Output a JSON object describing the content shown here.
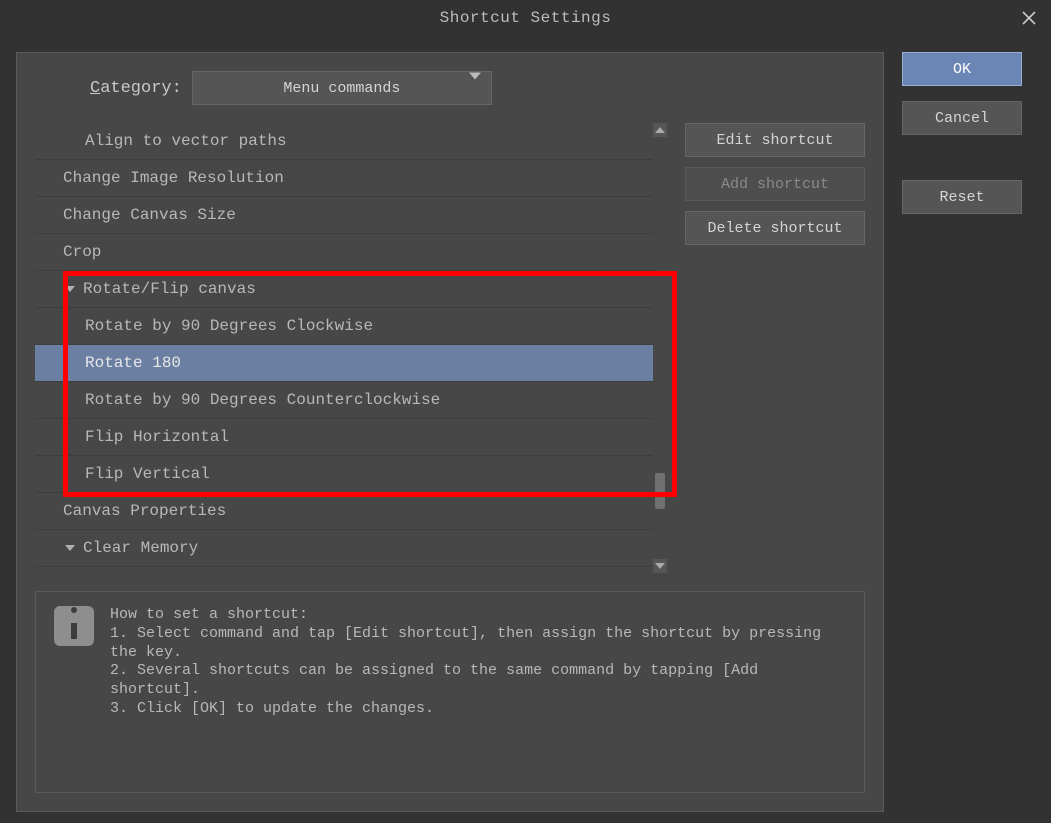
{
  "titlebar": {
    "title": "Shortcut Settings"
  },
  "category_label_prefix": "C",
  "category_label_rest": "ategory:",
  "category_select": {
    "value": "Menu commands"
  },
  "tree": {
    "items": [
      {
        "label": "Align to vector paths",
        "indent": "child",
        "caret": false
      },
      {
        "label": "Change Image Resolution",
        "indent": "parent",
        "caret": false
      },
      {
        "label": "Change Canvas Size",
        "indent": "parent",
        "caret": false
      },
      {
        "label": "Crop",
        "indent": "parent",
        "caret": false
      },
      {
        "label": "Rotate/Flip canvas",
        "indent": "parent",
        "caret": true
      },
      {
        "label": "Rotate by 90 Degrees Clockwise",
        "indent": "child",
        "caret": false
      },
      {
        "label": "Rotate 180",
        "indent": "child",
        "caret": false,
        "selected": true
      },
      {
        "label": "Rotate by 90 Degrees Counterclockwise",
        "indent": "child",
        "caret": false
      },
      {
        "label": "Flip Horizontal",
        "indent": "child",
        "caret": false
      },
      {
        "label": "Flip Vertical",
        "indent": "child",
        "caret": false
      },
      {
        "label": "Canvas Properties",
        "indent": "parent",
        "caret": false
      },
      {
        "label": "Clear Memory",
        "indent": "parent",
        "caret": true
      }
    ]
  },
  "actions": {
    "edit": "Edit shortcut",
    "add": "Add shortcut",
    "delete": "Delete shortcut"
  },
  "right": {
    "ok": "OK",
    "cancel": "Cancel",
    "reset": "Reset"
  },
  "info": {
    "text": "How to set a shortcut:\n1. Select command and tap [Edit shortcut], then assign the shortcut by pressing the key.\n2. Several shortcuts can be assigned to the same command by tapping [Add shortcut].\n3. Click [OK] to update the changes."
  }
}
